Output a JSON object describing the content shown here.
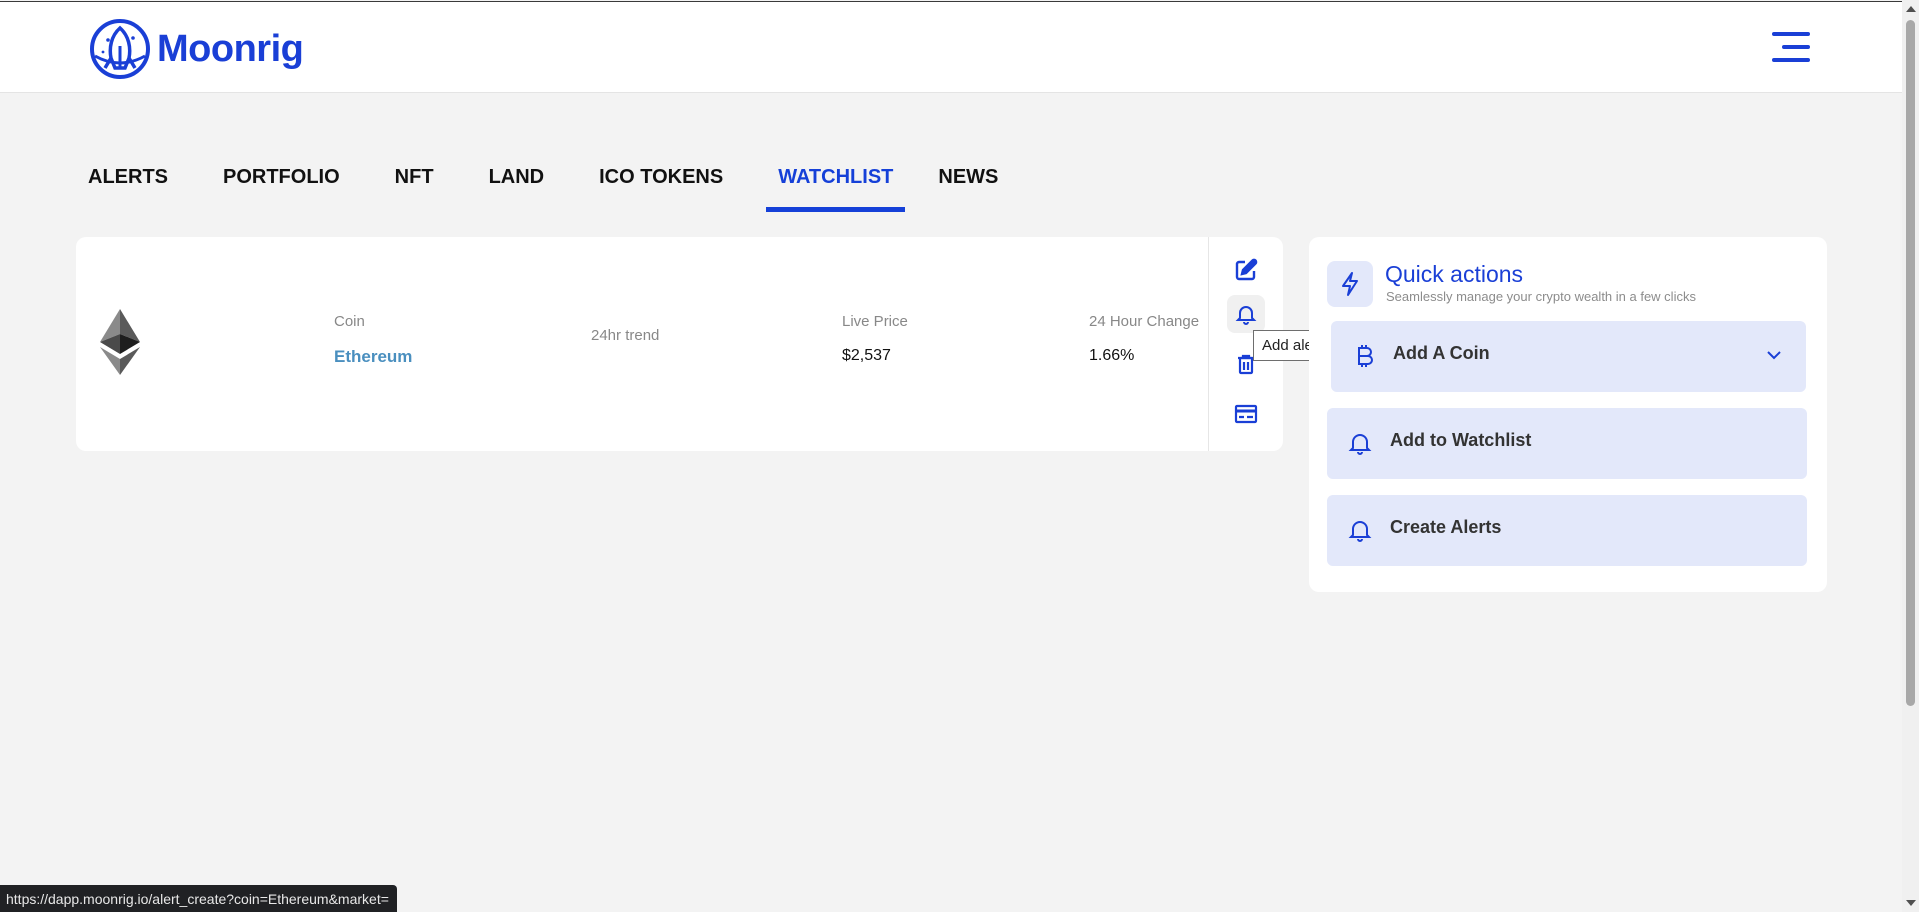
{
  "brand": {
    "name": "Moonrig",
    "color": "#1a3fd6"
  },
  "header": {
    "menu_icon": "hamburger-menu-icon"
  },
  "tabs": [
    {
      "label": "ALERTS",
      "active": false
    },
    {
      "label": "PORTFOLIO",
      "active": false
    },
    {
      "label": "NFT",
      "active": false
    },
    {
      "label": "LAND",
      "active": false
    },
    {
      "label": "ICO TOKENS",
      "active": false
    },
    {
      "label": "WATCHLIST",
      "active": true
    },
    {
      "label": "NEWS",
      "active": false
    }
  ],
  "watchlist": {
    "columns": {
      "coin": "Coin",
      "trend": "24hr trend",
      "price": "Live Price",
      "change": "24 Hour Change"
    },
    "rows": [
      {
        "icon": "ethereum-icon",
        "coin": "Ethereum",
        "price": "$2,537",
        "change": "1.66%"
      }
    ],
    "row_actions": [
      "edit-icon",
      "bell-icon",
      "trash-icon",
      "card-icon"
    ]
  },
  "tooltip": {
    "text": "Add alert"
  },
  "quick_actions": {
    "title": "Quick actions",
    "subtitle": "Seamlessly manage your crypto wealth in a few clicks",
    "icon": "lightning-icon",
    "items": [
      {
        "label": "Add A Coin",
        "icon": "bitcoin-icon",
        "has_dropdown": true
      },
      {
        "label": "Add to Watchlist",
        "icon": "bell-icon"
      },
      {
        "label": "Create Alerts",
        "icon": "bell-icon"
      }
    ]
  },
  "status_bar": {
    "url": "https://dapp.moonrig.io/alert_create?coin=Ethereum&market="
  },
  "colors": {
    "accent": "#1540d8",
    "panel_item_bg": "#e3e8fa",
    "coin_link": "#4a8fbf"
  }
}
